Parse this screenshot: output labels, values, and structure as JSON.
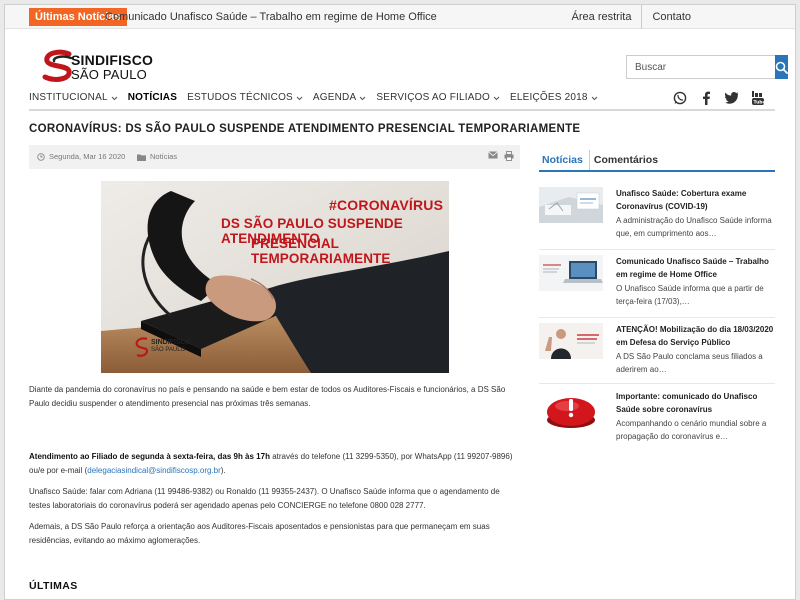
{
  "topbar": {
    "badge": "Últimas Notícias",
    "ticker": "Comunicado Unafisco Saúde – Trabalho em regime de Home Office",
    "links": [
      "Área restrita",
      "Contato"
    ]
  },
  "logo": {
    "line1": "SINDIFISCO",
    "line2": "SÃO PAULO"
  },
  "search": {
    "placeholder": "Buscar"
  },
  "nav": {
    "items": [
      {
        "label": "INSTITUCIONAL",
        "chevron": true
      },
      {
        "label": "NOTÍCIAS",
        "chevron": false,
        "active": true
      },
      {
        "label": "ESTUDOS TÉCNICOS",
        "chevron": true
      },
      {
        "label": "AGENDA",
        "chevron": true
      },
      {
        "label": "SERVIÇOS AO FILIADO",
        "chevron": true
      },
      {
        "label": "ELEIÇÕES 2018",
        "chevron": true
      }
    ],
    "social": [
      "whatsapp-icon",
      "facebook-icon",
      "twitter-icon",
      "youtube-icon"
    ]
  },
  "article": {
    "title": "CORONAVÍRUS: DS SÃO PAULO SUSPENDE ATENDIMENTO PRESENCIAL TEMPORARIAMENTE",
    "date": "Segunda, Mar 16 2020",
    "category": "Notícias",
    "hero": {
      "hashtag": "#CORONAVÍRUS",
      "line1": "DS SÃO PAULO SUSPENDE ATENDIMENTO",
      "line2": "PRESENCIAL TEMPORARIAMENTE",
      "logo1": "SINDIFISCO",
      "logo2": "SÃO PAULO"
    },
    "p1": "Diante da pandemia do coronavírus no país e pensando na saúde e bem estar de todos os Auditores-Fiscais e funcionários, a DS São Paulo decidiu suspender o atendimento presencial nas próximas três semanas.",
    "p2_bold": "Atendimento ao Filiado de segunda à sexta-feira, das 9h às 17h",
    "p2_rest": " através do telefone (11 3299-5350), por WhatsApp (11 99207-9896) ou/e por e-mail (",
    "p2_email": "delegaciasindical@sindifiscosp.org.br",
    "p2_end": ").",
    "p3": "Unafisco Saúde: falar com Adriana (11 99486-9382) ou Ronaldo (11 99355-2437). O Unafisco Saúde informa que o agendamento de testes laboratoriais do coronavírus poderá ser agendado apenas pelo CONCIERGE no telefone 0800 028 2777.",
    "p4": "Ademais, a DS São Paulo reforça a orientação aos Auditores-Fiscais aposentados e pensionistas para que permaneçam em suas residências, evitando ao máximo aglomerações."
  },
  "ultimas": "ÚLTIMAS",
  "sidebar": {
    "tabs": [
      "Notícias",
      "Comentários"
    ],
    "posts": [
      {
        "title": "Unafisco Saúde: Cobertura exame Coronavírus (COVID-19)",
        "excerpt": "A administração do Unafisco Saúde informa que, em cumprimento aos…"
      },
      {
        "title": "Comunicado Unafisco Saúde – Trabalho em regime de Home Office",
        "excerpt": "O Unafisco Saúde informa que a partir de terça-feira (17/03),…"
      },
      {
        "title": "ATENÇÃO! Mobilização do dia 18/03/2020 em Defesa do Serviço Público",
        "excerpt": "A DS São Paulo conclama seus filiados a aderirem ao…"
      },
      {
        "title": "Importante: comunicado do Unafisco Saúde sobre coronavírus",
        "excerpt": "Acompanhando o cenário mundial sobre a propagação do coronavírus e…"
      }
    ]
  },
  "colors": {
    "accent": "#2a74b9",
    "badge": "#f26522",
    "brand_red": "#c0161b"
  }
}
